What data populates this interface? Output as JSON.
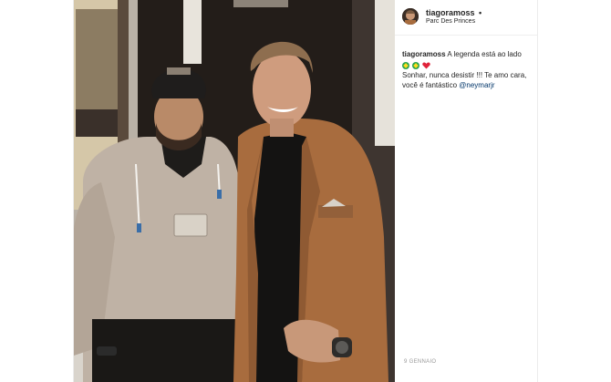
{
  "post": {
    "username": "tiagoramoss",
    "separator": "•",
    "location": "Parc Des Princes",
    "caption": {
      "username": "tiagoramoss",
      "line1": "A legenda está ao lado",
      "line2": "Sonhar, nunca desistir !!! Te amo cara, você é fantástico",
      "mention": "@neymarjr",
      "emojis": [
        "brazil-flag-icon",
        "brazil-flag-icon",
        "red-heart-icon"
      ]
    },
    "date": "9 GENNAIO"
  },
  "colors": {
    "mention": "#003569",
    "text": "#262626",
    "muted": "#999999"
  }
}
